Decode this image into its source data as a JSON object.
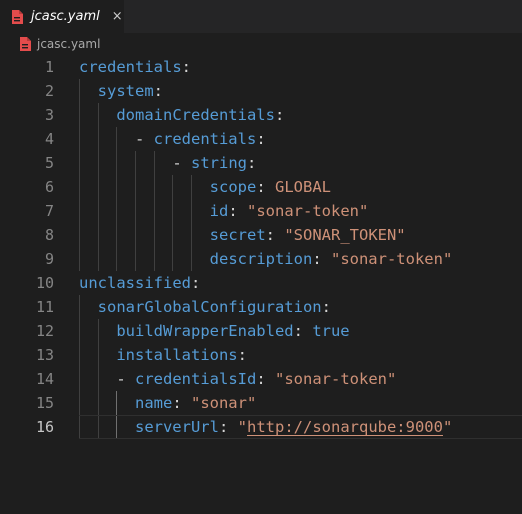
{
  "tab": {
    "filename": "jcasc.yaml",
    "close_glyph": "×",
    "icon": "yaml-file-icon",
    "icon_color": "#e44c4c"
  },
  "breadcrumb": {
    "filename": "jcasc.yaml",
    "icon": "yaml-file-icon"
  },
  "editor": {
    "active_line": 16,
    "lines": [
      {
        "n": "1",
        "indent": 0,
        "tokens": [
          {
            "t": "credentials",
            "c": "k"
          },
          {
            "t": ":",
            "c": "p"
          }
        ]
      },
      {
        "n": "2",
        "indent": 1,
        "tokens": [
          {
            "t": "system",
            "c": "k"
          },
          {
            "t": ":",
            "c": "p"
          }
        ]
      },
      {
        "n": "3",
        "indent": 2,
        "tokens": [
          {
            "t": "domainCredentials",
            "c": "k"
          },
          {
            "t": ":",
            "c": "p"
          }
        ]
      },
      {
        "n": "4",
        "indent": 3,
        "tokens": [
          {
            "t": "- ",
            "c": "p"
          },
          {
            "t": "credentials",
            "c": "k"
          },
          {
            "t": ":",
            "c": "p"
          }
        ]
      },
      {
        "n": "5",
        "indent": 5,
        "tokens": [
          {
            "t": "- ",
            "c": "p"
          },
          {
            "t": "string",
            "c": "k"
          },
          {
            "t": ":",
            "c": "p"
          }
        ]
      },
      {
        "n": "6",
        "indent": 7,
        "tokens": [
          {
            "t": "scope",
            "c": "k"
          },
          {
            "t": ": ",
            "c": "p"
          },
          {
            "t": "GLOBAL",
            "c": "s"
          }
        ]
      },
      {
        "n": "7",
        "indent": 7,
        "tokens": [
          {
            "t": "id",
            "c": "k"
          },
          {
            "t": ": ",
            "c": "p"
          },
          {
            "t": "\"sonar-token\"",
            "c": "s"
          }
        ]
      },
      {
        "n": "8",
        "indent": 7,
        "tokens": [
          {
            "t": "secret",
            "c": "k"
          },
          {
            "t": ": ",
            "c": "p"
          },
          {
            "t": "\"SONAR_TOKEN\"",
            "c": "s"
          }
        ]
      },
      {
        "n": "9",
        "indent": 7,
        "tokens": [
          {
            "t": "description",
            "c": "k"
          },
          {
            "t": ": ",
            "c": "p"
          },
          {
            "t": "\"sonar-token\"",
            "c": "s"
          }
        ]
      },
      {
        "n": "10",
        "indent": 0,
        "tokens": [
          {
            "t": "unclassified",
            "c": "k"
          },
          {
            "t": ":",
            "c": "p"
          }
        ]
      },
      {
        "n": "11",
        "indent": 1,
        "tokens": [
          {
            "t": "sonarGlobalConfiguration",
            "c": "k"
          },
          {
            "t": ":",
            "c": "p"
          }
        ]
      },
      {
        "n": "12",
        "indent": 2,
        "tokens": [
          {
            "t": "buildWrapperEnabled",
            "c": "k"
          },
          {
            "t": ": ",
            "c": "p"
          },
          {
            "t": "true",
            "c": "b"
          }
        ]
      },
      {
        "n": "13",
        "indent": 2,
        "tokens": [
          {
            "t": "installations",
            "c": "k"
          },
          {
            "t": ":",
            "c": "p"
          }
        ]
      },
      {
        "n": "14",
        "indent": 2,
        "tokens": [
          {
            "t": "- ",
            "c": "p"
          },
          {
            "t": "credentialsId",
            "c": "k"
          },
          {
            "t": ": ",
            "c": "p"
          },
          {
            "t": "\"sonar-token\"",
            "c": "s"
          }
        ]
      },
      {
        "n": "15",
        "indent": 3,
        "tokens": [
          {
            "t": "name",
            "c": "k"
          },
          {
            "t": ": ",
            "c": "p"
          },
          {
            "t": "\"sonar\"",
            "c": "s"
          }
        ]
      },
      {
        "n": "16",
        "indent": 3,
        "tokens": [
          {
            "t": "serverUrl",
            "c": "k"
          },
          {
            "t": ": ",
            "c": "p"
          },
          {
            "t": "\"",
            "c": "s"
          },
          {
            "t": "http://sonarqube:9000",
            "c": "u"
          },
          {
            "t": "\"",
            "c": "s"
          }
        ]
      }
    ]
  }
}
